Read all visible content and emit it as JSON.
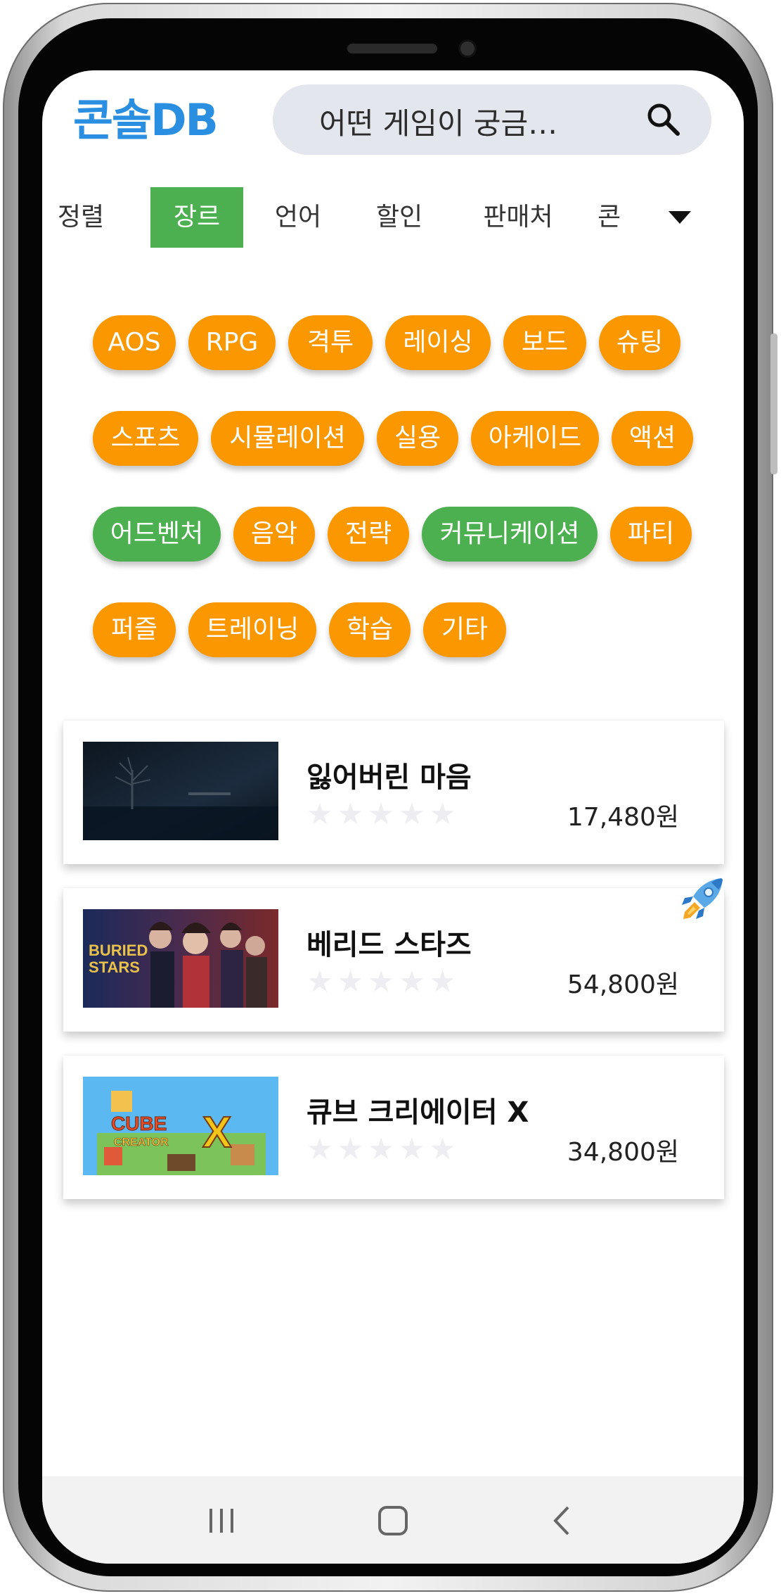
{
  "app": {
    "logo": "콘솔DB"
  },
  "search": {
    "placeholder": "어떤 게임이 궁금…"
  },
  "filters": {
    "tabs": [
      {
        "label": "정렬",
        "active": false
      },
      {
        "label": "장르",
        "active": true
      },
      {
        "label": "언어",
        "active": false
      },
      {
        "label": "할인",
        "active": false
      },
      {
        "label": "판매처",
        "active": false
      },
      {
        "label": "콘솔",
        "active": false
      }
    ]
  },
  "genres": [
    {
      "label": "AOS",
      "selected": false
    },
    {
      "label": "RPG",
      "selected": false
    },
    {
      "label": "격투",
      "selected": false
    },
    {
      "label": "레이싱",
      "selected": false
    },
    {
      "label": "보드",
      "selected": false
    },
    {
      "label": "슈팅",
      "selected": false
    },
    {
      "label": "스포츠",
      "selected": false
    },
    {
      "label": "시뮬레이션",
      "selected": false
    },
    {
      "label": "실용",
      "selected": false
    },
    {
      "label": "아케이드",
      "selected": false
    },
    {
      "label": "액션",
      "selected": false
    },
    {
      "label": "어드벤처",
      "selected": true
    },
    {
      "label": "음악",
      "selected": false
    },
    {
      "label": "전략",
      "selected": false
    },
    {
      "label": "커뮤니케이션",
      "selected": true
    },
    {
      "label": "파티",
      "selected": false
    },
    {
      "label": "퍼즐",
      "selected": false
    },
    {
      "label": "트레이닝",
      "selected": false
    },
    {
      "label": "학습",
      "selected": false
    },
    {
      "label": "기타",
      "selected": false
    }
  ],
  "games": [
    {
      "title": "잃어버린 마음",
      "price": "17,480원",
      "stars": "★★★★★",
      "rating": 0,
      "thumbnail_text": "",
      "badge_icon": ""
    },
    {
      "title": "베리드 스타즈",
      "price": "54,800원",
      "stars": "★★★★★",
      "rating": 0,
      "thumbnail_text": "BURIED STARS",
      "badge_icon": "rocket-icon"
    },
    {
      "title": "큐브 크리에이터 X",
      "price": "34,800원",
      "stars": "★★★★★",
      "rating": 0,
      "thumbnail_text": "CUBE CREATOR X",
      "badge_icon": ""
    }
  ],
  "colors": {
    "brand": "#2a8fe0",
    "chip_default": "#fb9700",
    "chip_selected": "#4caf50",
    "tab_active": "#4caf50",
    "star_empty": "#eeeef2"
  },
  "system_nav": {
    "icons": [
      "recent-apps-icon",
      "home-icon",
      "back-icon"
    ]
  }
}
